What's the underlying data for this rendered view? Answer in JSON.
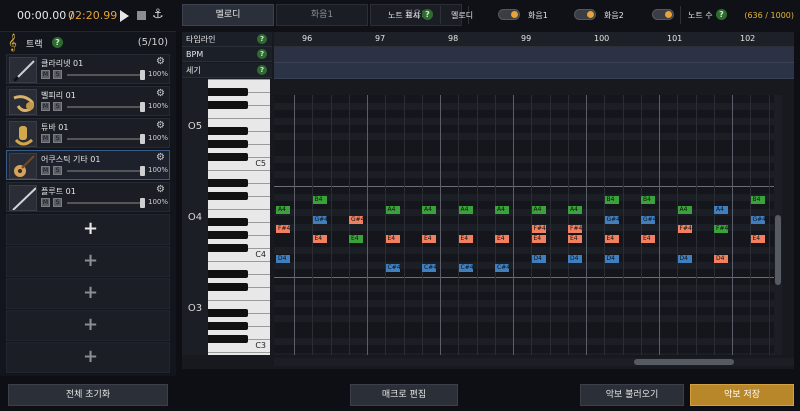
{
  "transport": {
    "current_time": "00:00.00 /",
    "total_time": "02:20.99"
  },
  "tracks": {
    "label": "트랙",
    "count": "(5/10)",
    "items": [
      {
        "name": "클라리넷 01",
        "volume": "100%"
      },
      {
        "name": "벨피리 01",
        "volume": "100%"
      },
      {
        "name": "튜바 01",
        "volume": "100%"
      },
      {
        "name": "어쿠스틱 기타 01",
        "volume": "100%"
      },
      {
        "name": "플루트 01",
        "volume": "100%"
      }
    ],
    "mute_label": "M",
    "solo_label": "S"
  },
  "tabs": [
    "멜로디",
    "화음1",
    "화음2"
  ],
  "options": {
    "note_display": "노트 표시",
    "melody": "멜로디",
    "harmony1": "화음1",
    "harmony2": "화음2",
    "note_count_label": "노트 수",
    "note_count": "(636 / 1000)"
  },
  "editor": {
    "rows": [
      "타임라인",
      "BPM",
      "세기"
    ],
    "bars": [
      "96",
      "97",
      "98",
      "99",
      "100",
      "101",
      "102"
    ],
    "octaves": [
      "O5",
      "O4",
      "O3"
    ],
    "c_labels": [
      "C5",
      "C4",
      "C3"
    ]
  },
  "notes": [
    {
      "t": "A4",
      "c": "g",
      "x": 0,
      "r": 0
    },
    {
      "t": "F#4",
      "c": "r",
      "x": 0,
      "r": 2
    },
    {
      "t": "D4",
      "c": "b",
      "x": 0,
      "r": 5
    },
    {
      "t": "B4",
      "c": "g",
      "x": 1,
      "r": -1
    },
    {
      "t": "G#4",
      "c": "b",
      "x": 1,
      "r": 1
    },
    {
      "t": "E4",
      "c": "r",
      "x": 1,
      "r": 3
    },
    {
      "t": "G#4",
      "c": "r",
      "x": 2,
      "r": 1
    },
    {
      "t": "E4",
      "c": "g",
      "x": 2,
      "r": 3
    },
    {
      "t": "A4",
      "c": "g",
      "x": 3,
      "r": 0
    },
    {
      "t": "E4",
      "c": "r",
      "x": 3,
      "r": 3
    },
    {
      "t": "C#4",
      "c": "b",
      "x": 3,
      "r": 6
    },
    {
      "t": "A4",
      "c": "g",
      "x": 4,
      "r": 0
    },
    {
      "t": "E4",
      "c": "r",
      "x": 4,
      "r": 3
    },
    {
      "t": "C#4",
      "c": "b",
      "x": 4,
      "r": 6
    },
    {
      "t": "A4",
      "c": "g",
      "x": 5,
      "r": 0
    },
    {
      "t": "E4",
      "c": "r",
      "x": 5,
      "r": 3
    },
    {
      "t": "C#4",
      "c": "b",
      "x": 5,
      "r": 6
    },
    {
      "t": "A4",
      "c": "g",
      "x": 6,
      "r": 0
    },
    {
      "t": "E4",
      "c": "r",
      "x": 6,
      "r": 3
    },
    {
      "t": "C#4",
      "c": "b",
      "x": 6,
      "r": 6
    },
    {
      "t": "A4",
      "c": "g",
      "x": 7,
      "r": 0
    },
    {
      "t": "F#4",
      "c": "r",
      "x": 7,
      "r": 2
    },
    {
      "t": "E4",
      "c": "r",
      "x": 7,
      "r": 3
    },
    {
      "t": "D4",
      "c": "b",
      "x": 7,
      "r": 5
    },
    {
      "t": "A4",
      "c": "g",
      "x": 8,
      "r": 0
    },
    {
      "t": "F#4",
      "c": "r",
      "x": 8,
      "r": 2
    },
    {
      "t": "E4",
      "c": "r",
      "x": 8,
      "r": 3
    },
    {
      "t": "D4",
      "c": "b",
      "x": 8,
      "r": 5
    },
    {
      "t": "B4",
      "c": "g",
      "x": 9,
      "r": -1
    },
    {
      "t": "G#4",
      "c": "b",
      "x": 9,
      "r": 1
    },
    {
      "t": "E4",
      "c": "r",
      "x": 9,
      "r": 3
    },
    {
      "t": "D4",
      "c": "b",
      "x": 9,
      "r": 5
    },
    {
      "t": "B4",
      "c": "g",
      "x": 10,
      "r": -1
    },
    {
      "t": "G#4",
      "c": "b",
      "x": 10,
      "r": 1
    },
    {
      "t": "E4",
      "c": "r",
      "x": 10,
      "r": 3
    },
    {
      "t": "A4",
      "c": "g",
      "x": 11,
      "r": 0
    },
    {
      "t": "F#4",
      "c": "r",
      "x": 11,
      "r": 2
    },
    {
      "t": "D4",
      "c": "b",
      "x": 11,
      "r": 5
    },
    {
      "t": "A4",
      "c": "b",
      "x": 12,
      "r": 0
    },
    {
      "t": "F#4",
      "c": "g",
      "x": 12,
      "r": 2
    },
    {
      "t": "D4",
      "c": "r",
      "x": 12,
      "r": 5
    },
    {
      "t": "B4",
      "c": "g",
      "x": 13,
      "r": -1
    },
    {
      "t": "G#4",
      "c": "b",
      "x": 13,
      "r": 1
    },
    {
      "t": "E4",
      "c": "r",
      "x": 13,
      "r": 3
    }
  ],
  "bottom": {
    "reset": "전체 초기화",
    "macro": "매크로 편집",
    "load": "악보 불러오기",
    "save": "악보 저장"
  }
}
